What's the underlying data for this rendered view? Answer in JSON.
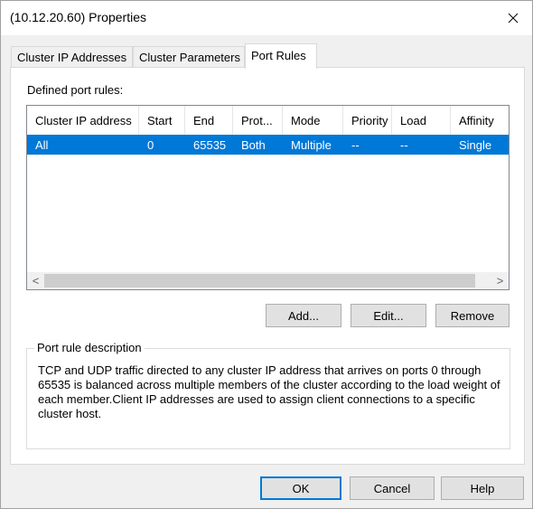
{
  "window": {
    "title": "(10.12.20.60) Properties",
    "close_icon": "close-icon"
  },
  "tabs": [
    {
      "label": "Cluster IP Addresses",
      "active": false
    },
    {
      "label": "Cluster Parameters",
      "active": false
    },
    {
      "label": "Port Rules",
      "active": true
    }
  ],
  "port_rules": {
    "section_label": "Defined port rules:",
    "columns": [
      "Cluster IP address",
      "Start",
      "End",
      "Prot...",
      "Mode",
      "Priority",
      "Load",
      "Affinity"
    ],
    "rows": [
      [
        "All",
        "0",
        "65535",
        "Both",
        "Multiple",
        "--",
        "--",
        "Single"
      ]
    ],
    "selected_row": 0,
    "scroll_left_glyph": "<",
    "scroll_right_glyph": ">"
  },
  "rule_buttons": {
    "add": "Add...",
    "edit": "Edit...",
    "remove": "Remove"
  },
  "description": {
    "label": "Port rule description",
    "text": "TCP and UDP traffic directed to any cluster IP address that arrives on ports 0 through 65535 is balanced across multiple members of the cluster according to the load weight of each member.Client IP addresses are used to assign client connections to a specific cluster host."
  },
  "dialog_buttons": {
    "ok": "OK",
    "cancel": "Cancel",
    "help": "Help"
  },
  "colors": {
    "selection": "#0078d7",
    "default_button_border": "#0078d7"
  }
}
